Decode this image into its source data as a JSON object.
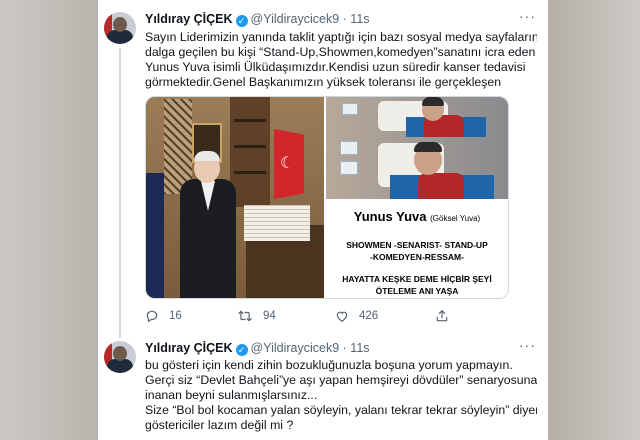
{
  "tweets": [
    {
      "author": "Yıldıray ÇİÇEK",
      "handle": "@Yildiraycicek9",
      "time": "11s",
      "text_lines": [
        "Sayın Liderimizin yanında taklit yaptığı için bazı sosyal medya sayfalarında",
        "dalga geçilen bu kişi “Stand-Up,Showmen,komedyen”sanatını icra eden",
        "Yunus Yuva isimli Ülküdaşımızdır.Kendisi uzun süredir kanser tedavisi",
        "görmektedir.Genel Başkanımızın yüksek toleransı ile gerçekleşen"
      ],
      "media": {
        "caption_name": "Yunus Yuva",
        "caption_alias": "(Göksel Yuva)",
        "caption_lines": [
          "SHOWMEN -SENARIST- STAND-UP",
          "-KOMEDYEN-RESSAM-",
          "HAYATTA KEŞKE DEME HİÇBİR ŞEYİ",
          "ÖTELEME ANI YAŞA"
        ]
      },
      "actions": {
        "replies": "16",
        "retweets": "94",
        "likes": "426"
      }
    },
    {
      "author": "Yıldıray ÇİÇEK",
      "handle": "@Yildiraycicek9",
      "time": "11s",
      "text_lines": [
        "bu gösteri için kendi zihin bozukluğunuzla boşuna yorum yapmayın.",
        "Gerçi siz “Devlet Bahçeli”ye aşı yapan hemşireyi dövdüler” senaryosuna bile",
        "inanan beyni sulanmışlarsınız...",
        "Size “Bol bol kocaman yalan söyleyin, yalanı tekrar tekrar söyleyin” diyen",
        "göstericiler lazım değil mi ?"
      ]
    }
  ],
  "icons": [
    "verified-badge-icon",
    "more-icon",
    "reply-icon",
    "retweet-icon",
    "like-icon",
    "share-icon"
  ],
  "colors": {
    "accent": "#1d9bf0",
    "text": "#0f1419",
    "muted": "#536471"
  }
}
